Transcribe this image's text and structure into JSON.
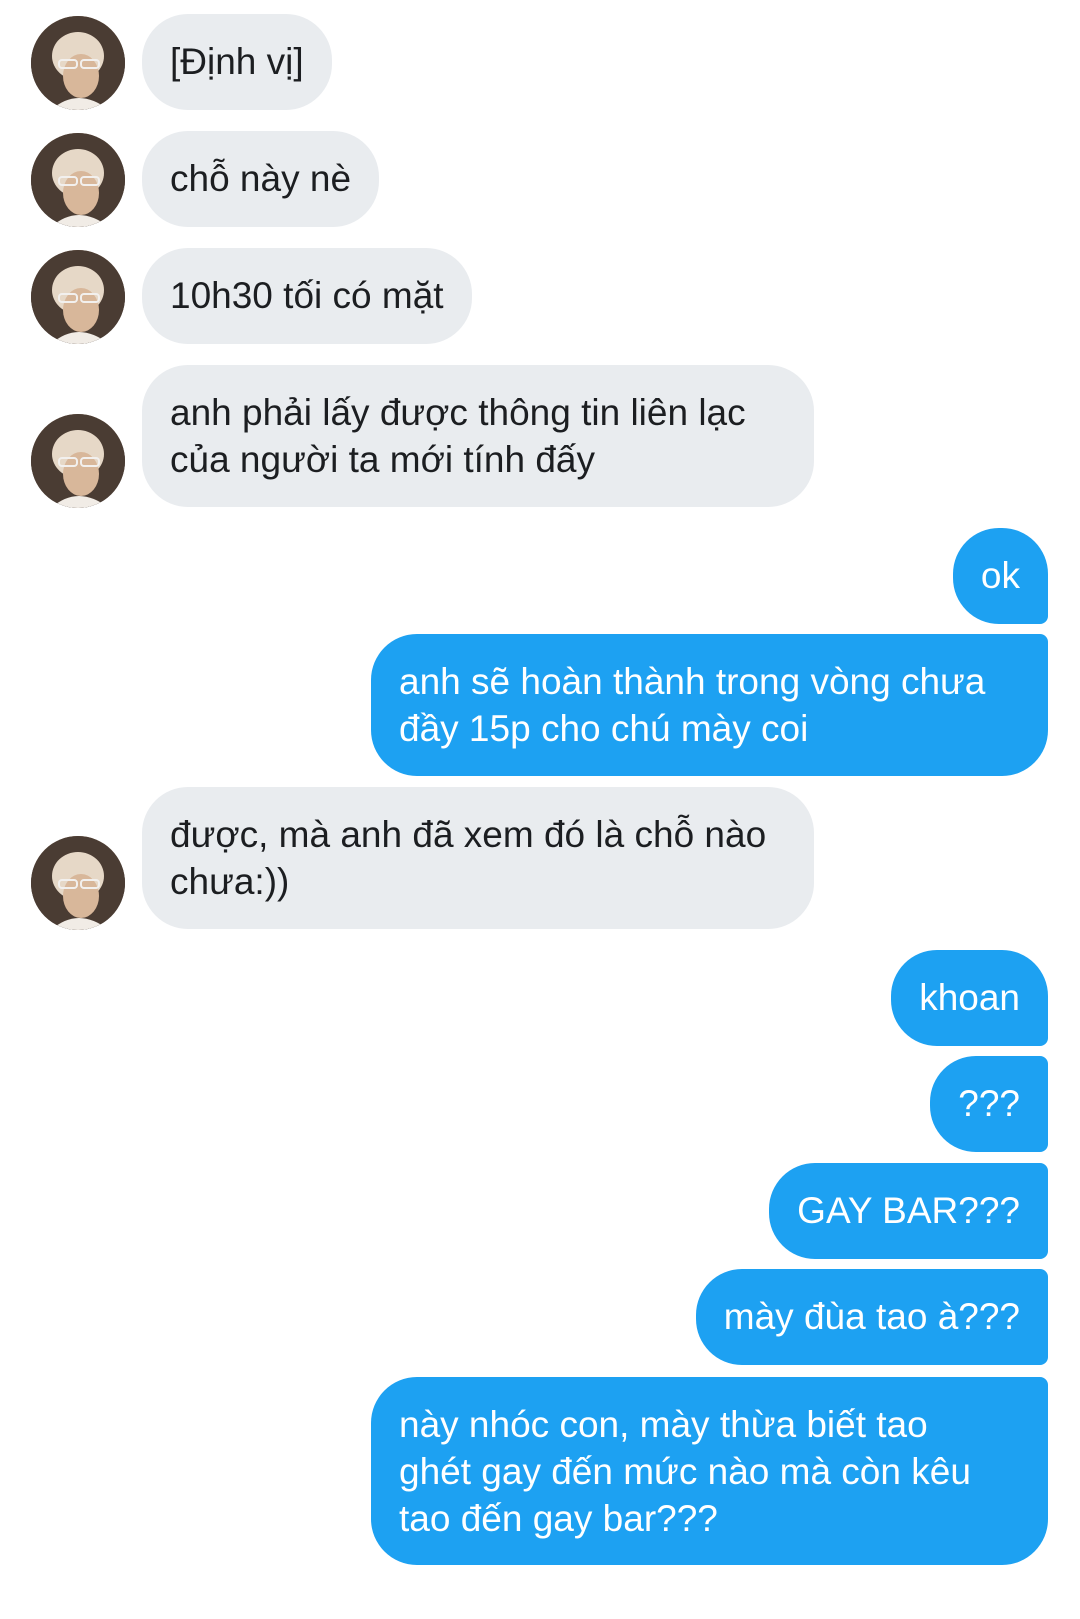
{
  "conversation": {
    "messages": [
      {
        "from": "other",
        "text": "[Định vị]"
      },
      {
        "from": "other",
        "text": "chỗ này nè"
      },
      {
        "from": "other",
        "text": "10h30 tối có mặt"
      },
      {
        "from": "other",
        "line1": "anh phải lấy được thông tin liên lạc",
        "line2": "của người ta mới tính đấy"
      },
      {
        "from": "me",
        "text": "ok"
      },
      {
        "from": "me",
        "line1": "anh sẽ hoàn thành trong vòng chưa",
        "line2": "đầy 15p cho chú mày coi"
      },
      {
        "from": "other",
        "line1": "được, mà anh đã xem đó là chỗ nào",
        "line2": "chưa:))"
      },
      {
        "from": "me",
        "text": "khoan"
      },
      {
        "from": "me",
        "text": "???"
      },
      {
        "from": "me",
        "text": "GAY BAR???"
      },
      {
        "from": "me",
        "text": "mày đùa tao à???"
      },
      {
        "from": "me",
        "line1": "này nhóc con, mày thừa biết tao",
        "line2": "ghét gay đến mức nào mà còn kêu",
        "line3": "tao đến gay bar???"
      }
    ]
  },
  "colors": {
    "incoming_bubble": "#e9ecef",
    "outgoing_bubble": "#1da1f2",
    "incoming_text": "#1c1e21",
    "outgoing_text": "#ffffff"
  }
}
